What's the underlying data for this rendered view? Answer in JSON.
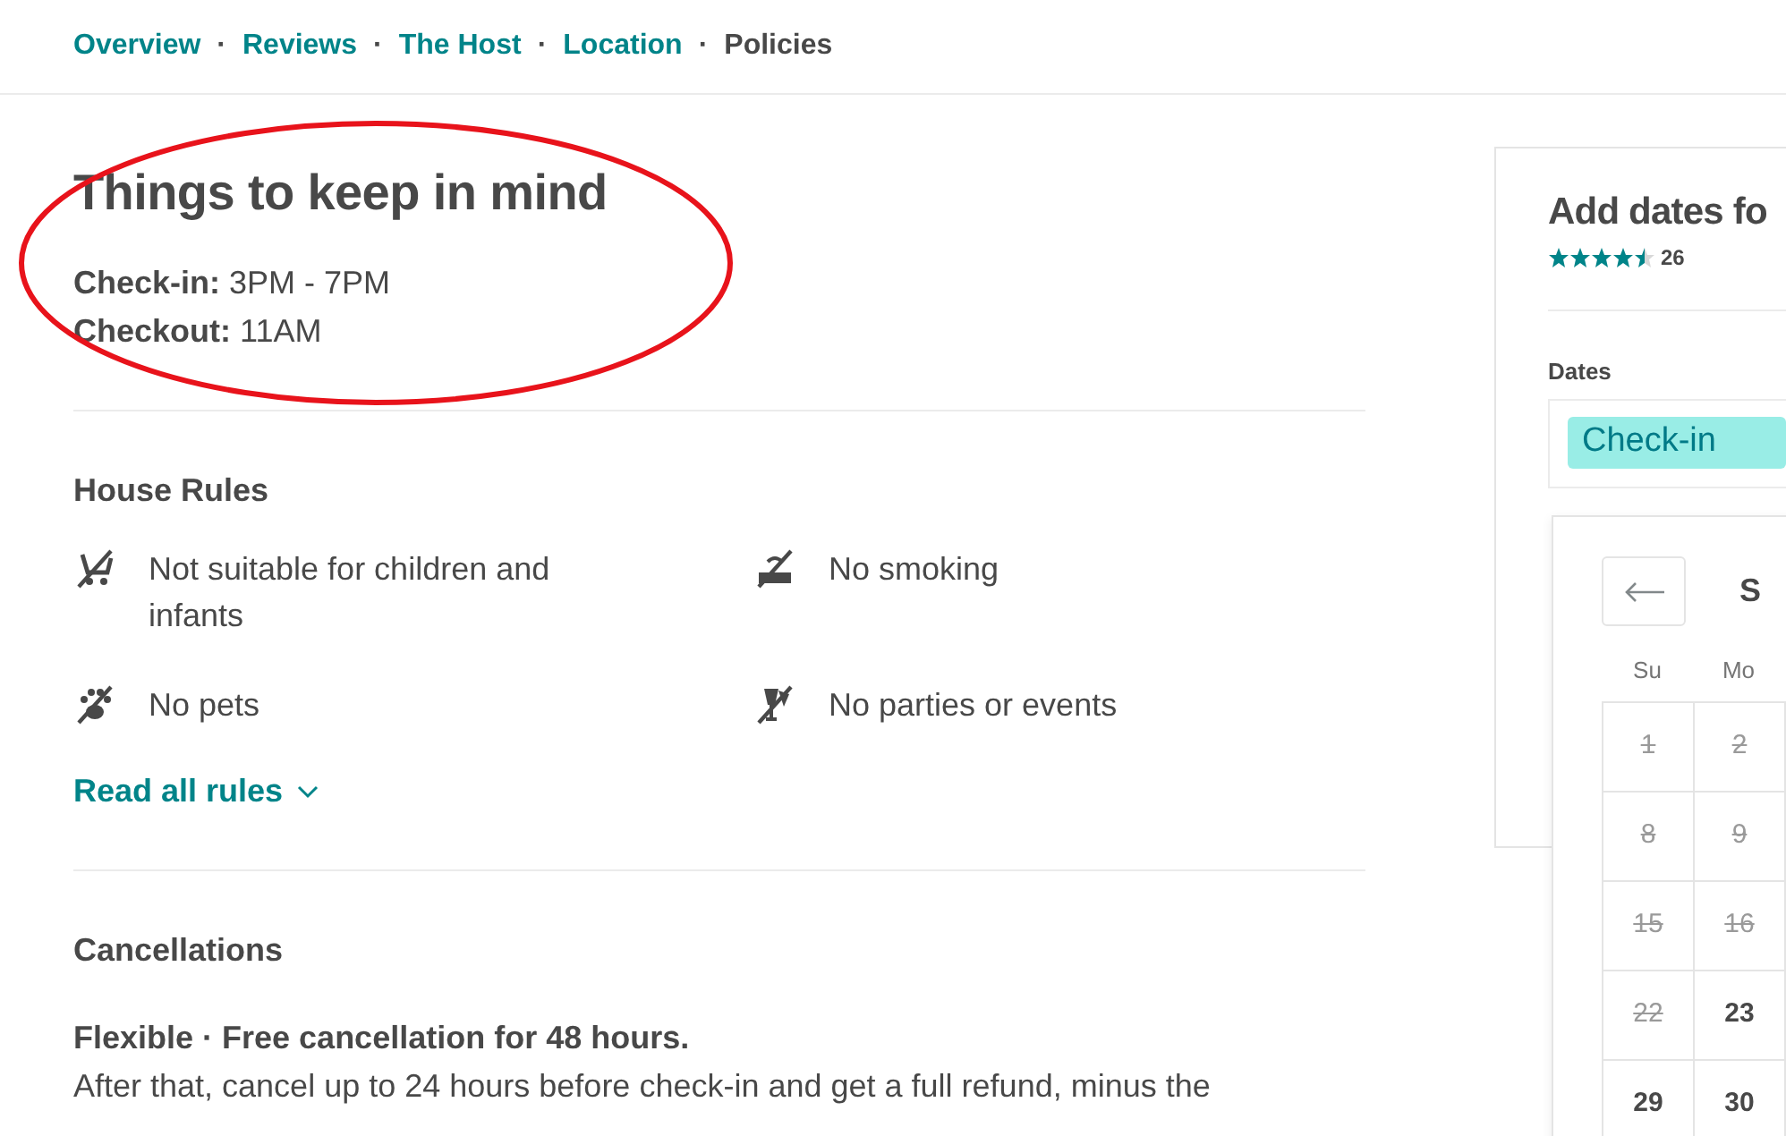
{
  "nav": [
    {
      "label": "Overview",
      "selected": false
    },
    {
      "label": "Reviews",
      "selected": false
    },
    {
      "label": "The Host",
      "selected": false
    },
    {
      "label": "Location",
      "selected": false
    },
    {
      "label": "Policies",
      "selected": true
    }
  ],
  "nav_separator": "·",
  "section": {
    "title": "Things to keep in mind",
    "checkin_label": "Check-in:",
    "checkin_value": "3PM - 7PM",
    "checkout_label": "Checkout:",
    "checkout_value": "11AM"
  },
  "house_rules": {
    "title": "House Rules",
    "rules": [
      {
        "kind": "children",
        "label": "Not suitable for children and infants"
      },
      {
        "kind": "smoking",
        "label": "No smoking"
      },
      {
        "kind": "pets",
        "label": "No pets"
      },
      {
        "kind": "parties",
        "label": "No parties or events"
      }
    ],
    "link": "Read all rules"
  },
  "cancellations": {
    "title": "Cancellations",
    "policy": "Flexible · Free cancellation for 48 hours.",
    "detail": "After that, cancel up to 24 hours before check-in and get a full refund, minus the"
  },
  "booking": {
    "title": "Add dates fo",
    "stars": 4.5,
    "review_count": "26",
    "dates_label": "Dates",
    "checkin_chip": "Check-in"
  },
  "calendar": {
    "month": "S",
    "weekdays": [
      "Su",
      "Mo"
    ],
    "weeks": [
      [
        {
          "day": "1",
          "disabled": true
        },
        {
          "day": "2",
          "disabled": true
        }
      ],
      [
        {
          "day": "8",
          "disabled": true
        },
        {
          "day": "9",
          "disabled": true
        }
      ],
      [
        {
          "day": "15",
          "disabled": true
        },
        {
          "day": "16",
          "disabled": true
        }
      ],
      [
        {
          "day": "22",
          "disabled": true
        },
        {
          "day": "23",
          "disabled": false
        }
      ],
      [
        {
          "day": "29",
          "disabled": false
        },
        {
          "day": "30",
          "disabled": false
        }
      ]
    ]
  }
}
